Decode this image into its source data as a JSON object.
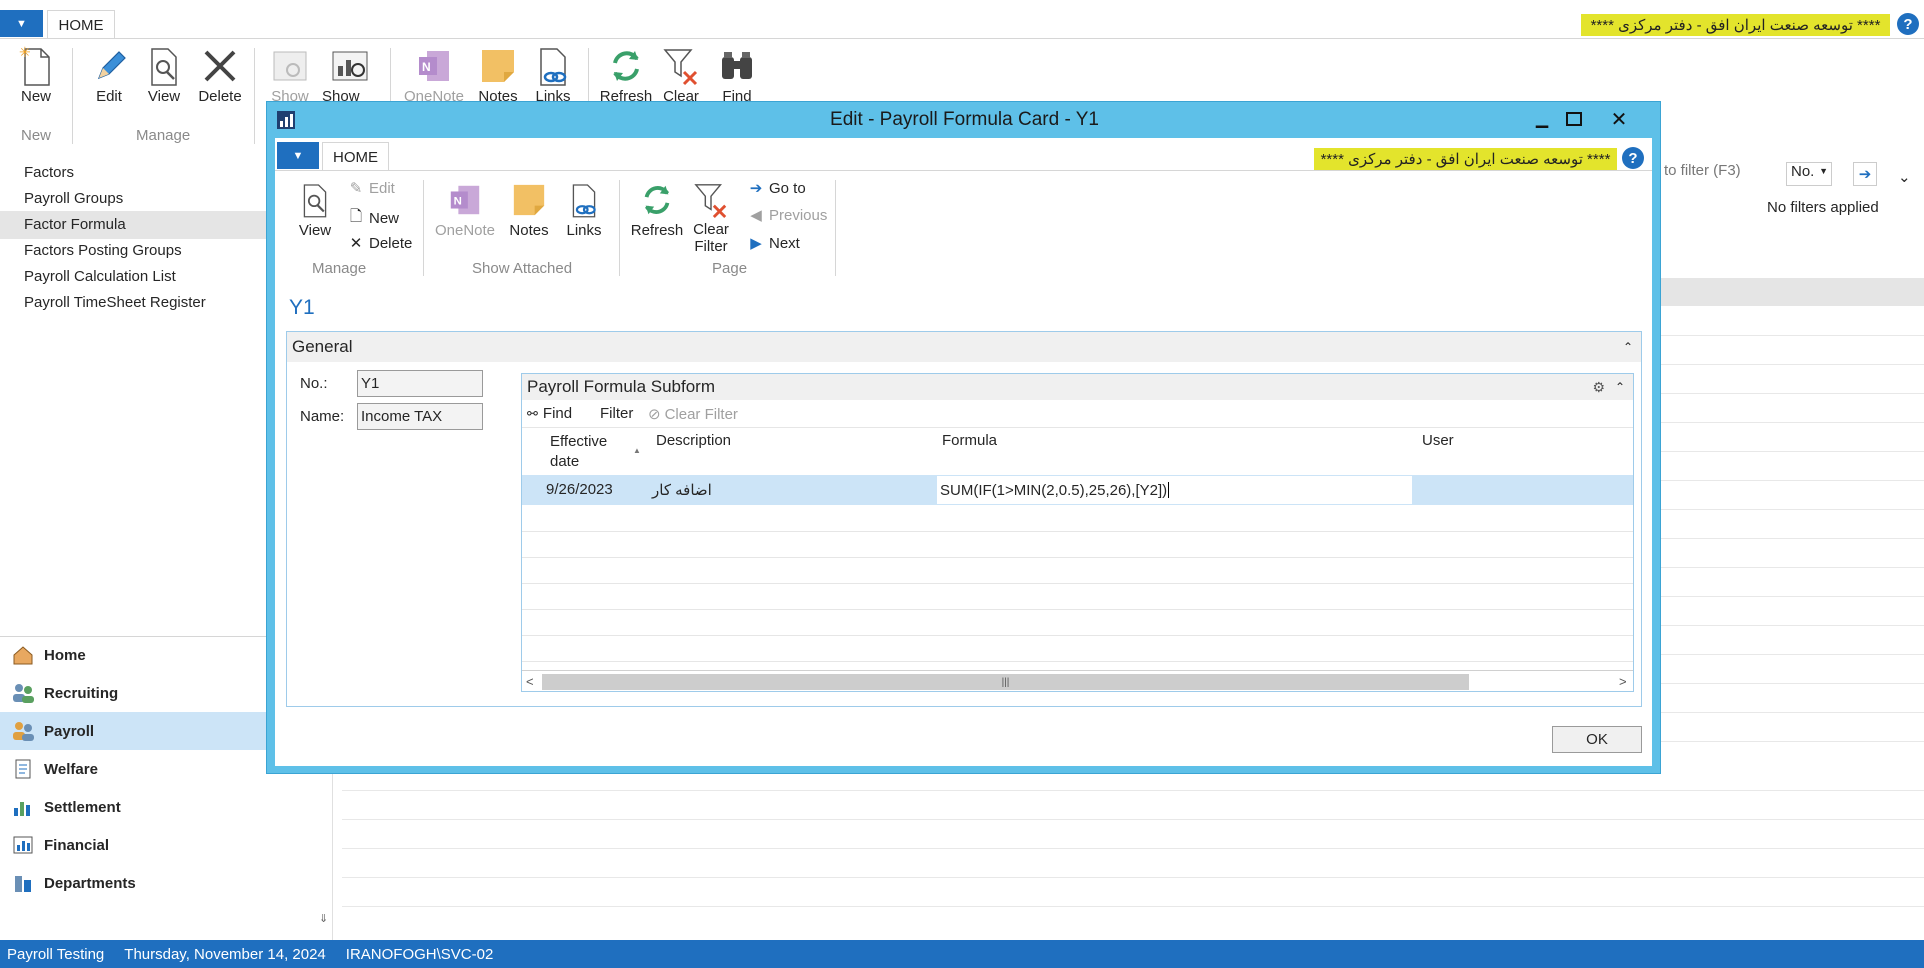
{
  "main_ribbon": {
    "tab": "HOME",
    "company": "****   توسعه صنعت ایران افق - دفتر مرکزی   ****",
    "help": "?",
    "buttons": {
      "new": "New",
      "edit": "Edit",
      "view": "View",
      "delete": "Delete",
      "show": "Show",
      "show_as": "Show as",
      "onenote": "OneNote",
      "notes": "Notes",
      "links": "Links",
      "refresh": "Refresh",
      "clear": "Clear",
      "find": "Find"
    },
    "groups": {
      "new": "New",
      "manage": "Manage"
    }
  },
  "nav": {
    "items": [
      "Factors",
      "Payroll Groups",
      "Factor Formula",
      "Factors Posting Groups",
      "Payroll Calculation List",
      "Payroll TimeSheet Register"
    ],
    "selected": "Factor Formula",
    "areas": [
      "Home",
      "Recruiting",
      "Payroll",
      "Welfare",
      "Settlement",
      "Financial",
      "Departments"
    ],
    "selected_area": "Payroll",
    "collapse": "⇓"
  },
  "background_list": {
    "filter_placeholder": "to filter (F3)",
    "filter_field": "No.",
    "no_filters": "No filters applied"
  },
  "status_bar": {
    "company": "Payroll Testing",
    "date": "Thursday, November 14, 2024",
    "user": "IRANOFOGH\\SVC-02"
  },
  "dialog": {
    "title": "Edit - Payroll Formula Card - Y1",
    "tab": "HOME",
    "company": "****   توسعه صنعت ایران افق - دفتر مرکزی   ****",
    "help": "?",
    "ribbon": {
      "view": "View",
      "edit": "Edit",
      "new": "New",
      "delete": "Delete",
      "onenote": "OneNote",
      "notes": "Notes",
      "links": "Links",
      "refresh": "Refresh",
      "clear_filter_1": "Clear",
      "clear_filter_2": "Filter",
      "go_to": "Go to",
      "previous": "Previous",
      "next": "Next",
      "group_manage": "Manage",
      "group_show_attached": "Show Attached",
      "group_page": "Page"
    },
    "record_title": "Y1",
    "general": {
      "header": "General",
      "no_label": "No.:",
      "no_value": "Y1",
      "name_label": "Name:",
      "name_value": "Income TAX"
    },
    "subform": {
      "header": "Payroll Formula Subform",
      "find": "Find",
      "filter": "Filter",
      "clear_filter": "Clear Filter",
      "columns": {
        "effective_1": "Effective",
        "effective_2": "date",
        "description": "Description",
        "formula": "Formula",
        "user": "User"
      },
      "rows": [
        {
          "effective_date": "9/26/2023",
          "description": "اضافه کار",
          "formula": "SUM(IF(1>MIN(2,0.5),25,26),[Y2])",
          "user": ""
        }
      ],
      "scroll_grip": "|||"
    },
    "ok": "OK"
  },
  "colors": {
    "accent": "#1f6fbf",
    "dialog_frame": "#5ec0e8",
    "banner": "#e3e42c",
    "selection": "#cce4f7"
  }
}
